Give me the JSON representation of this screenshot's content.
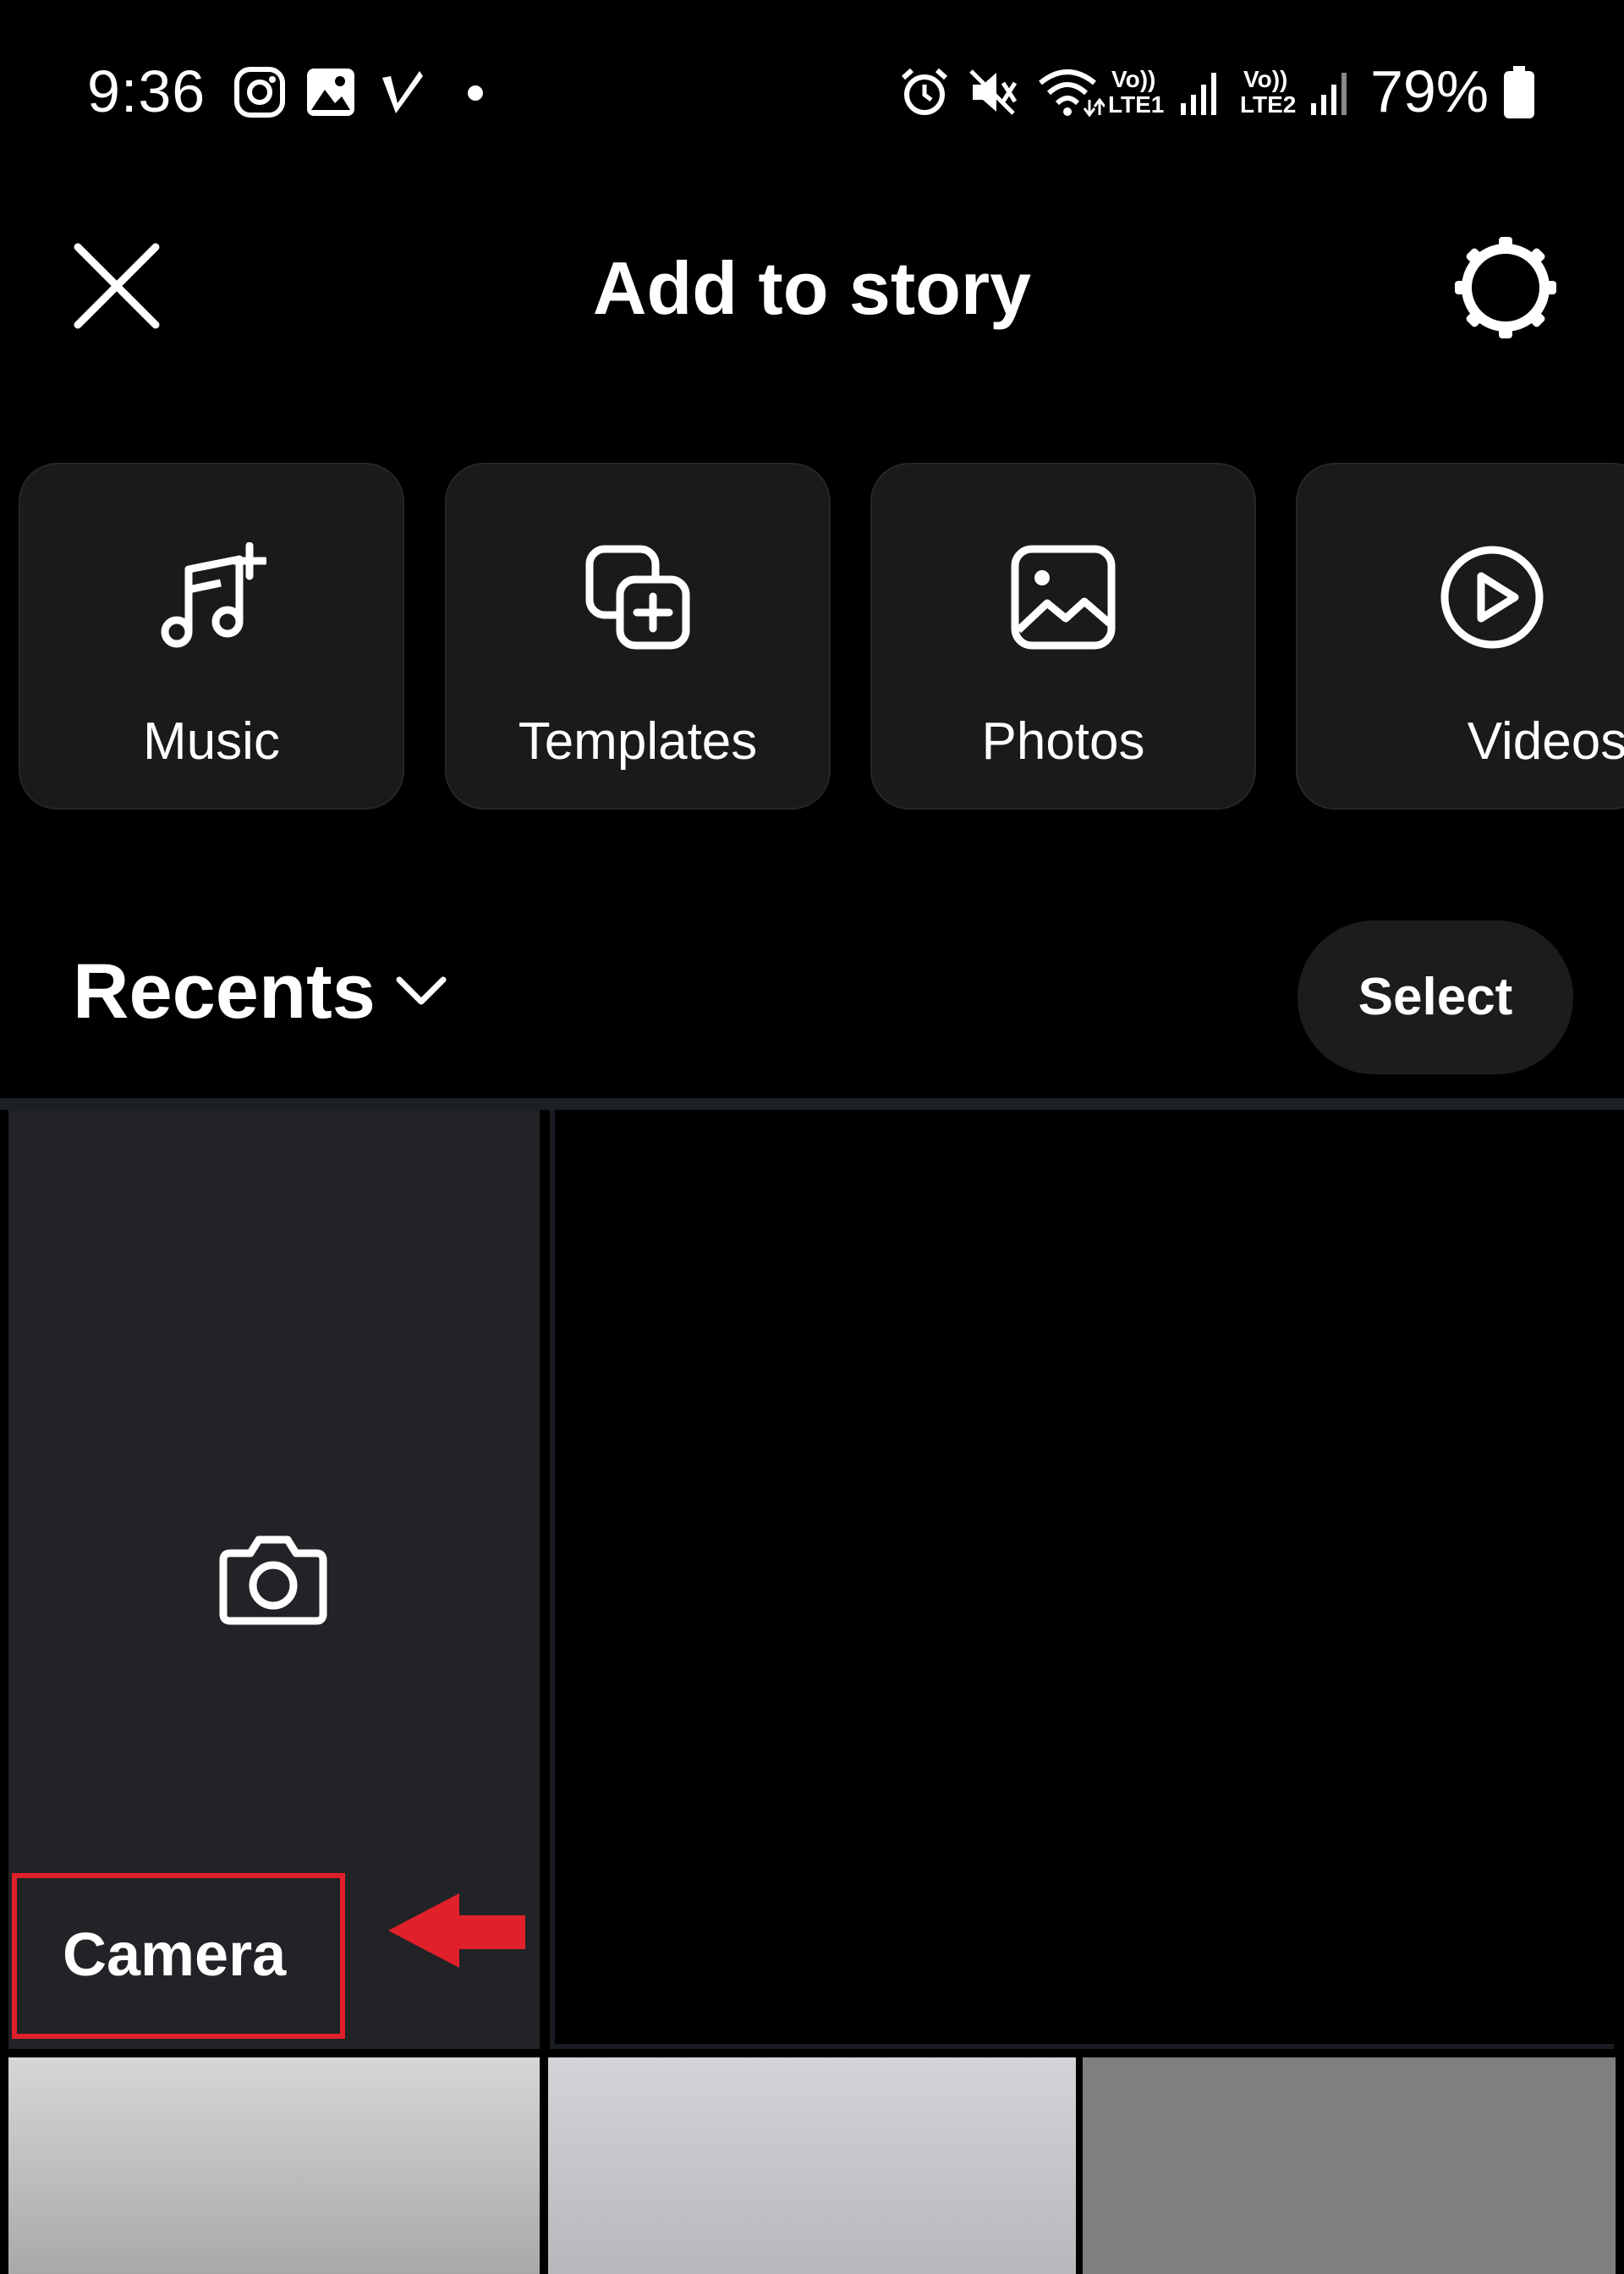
{
  "status_bar": {
    "time": "9:36",
    "battery": "79%",
    "sim1_label": "Vo))",
    "sim1_sub": "LTE1",
    "sim2_label": "Vo))",
    "sim2_sub": "LTE2",
    "icons": [
      "instagram-icon",
      "gallery-icon",
      "v-app-icon",
      "notification-dot",
      "alarm-icon",
      "mute-icon",
      "wifi-icon",
      "signal-icon",
      "battery-icon"
    ]
  },
  "header": {
    "title": "Add to story",
    "close_icon": "close-icon",
    "settings_icon": "settings-icon"
  },
  "quick_actions": [
    {
      "label": "Music",
      "icon": "music-add-icon"
    },
    {
      "label": "Templates",
      "icon": "templates-add-icon"
    },
    {
      "label": "Photos",
      "icon": "photo-icon"
    },
    {
      "label": "Videos",
      "icon": "play-circle-icon"
    }
  ],
  "gallery": {
    "album_label": "Recents",
    "select_label": "Select",
    "camera_label": "Camera"
  },
  "colors": {
    "background": "#000000",
    "card": "#1a1a1a",
    "camera_tile": "#222326",
    "highlight": "#e0202a"
  }
}
